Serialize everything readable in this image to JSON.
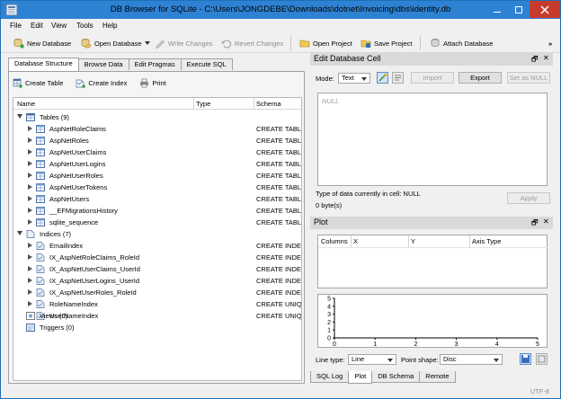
{
  "window": {
    "title": "DB Browser for SQLite - C:\\Users\\JONGDEBE\\Downloads\\dotnet\\Invoicing\\dbs\\identity.db"
  },
  "menu": [
    "File",
    "Edit",
    "View",
    "Tools",
    "Help"
  ],
  "toolbar": {
    "new_database": "New Database",
    "open_database": "Open Database",
    "write_changes": "Write Changes",
    "revert_changes": "Revert Changes",
    "open_project": "Open Project",
    "save_project": "Save Project",
    "attach_database": "Attach Database",
    "overflow": "»"
  },
  "left_tabs": [
    "Database Structure",
    "Browse Data",
    "Edit Pragmas",
    "Execute SQL"
  ],
  "structure_toolbar": {
    "create_table": "Create Table",
    "create_index": "Create Index",
    "print": "Print"
  },
  "tree_columns": {
    "name": "Name",
    "type": "Type",
    "schema": "Schema"
  },
  "tree": {
    "tables_label": "Tables (9)",
    "tables": [
      {
        "name": "AspNetRoleClaims",
        "schema": "CREATE TABLE"
      },
      {
        "name": "AspNetRoles",
        "schema": "CREATE TABLE"
      },
      {
        "name": "AspNetUserClaims",
        "schema": "CREATE TABLE"
      },
      {
        "name": "AspNetUserLogins",
        "schema": "CREATE TABLE"
      },
      {
        "name": "AspNetUserRoles",
        "schema": "CREATE TABLE"
      },
      {
        "name": "AspNetUserTokens",
        "schema": "CREATE TABLE"
      },
      {
        "name": "AspNetUsers",
        "schema": "CREATE TABLE"
      },
      {
        "name": "__EFMigrationsHistory",
        "schema": "CREATE TABLE"
      },
      {
        "name": "sqlite_sequence",
        "schema": "CREATE TABLE"
      }
    ],
    "indices_label": "Indices (7)",
    "indices": [
      {
        "name": "EmailIndex",
        "schema": "CREATE INDEX"
      },
      {
        "name": "IX_AspNetRoleClaims_RoleId",
        "schema": "CREATE INDEX"
      },
      {
        "name": "IX_AspNetUserClaims_UserId",
        "schema": "CREATE INDEX"
      },
      {
        "name": "IX_AspNetUserLogins_UserId",
        "schema": "CREATE INDEX"
      },
      {
        "name": "IX_AspNetUserRoles_RoleId",
        "schema": "CREATE INDEX"
      },
      {
        "name": "RoleNameIndex",
        "schema": "CREATE UNIQUE"
      },
      {
        "name": "UserNameIndex",
        "schema": "CREATE UNIQUE"
      }
    ],
    "views_label": "Views (0)",
    "triggers_label": "Triggers (0)"
  },
  "edit_cell": {
    "title": "Edit Database Cell",
    "mode_label": "Mode:",
    "mode_value": "Text",
    "import": "Import",
    "export": "Export",
    "set_null": "Set as NULL",
    "placeholder": "NULL",
    "type_info": "Type of data currently in cell: NULL",
    "size_info": "0 byte(s)",
    "apply": "Apply"
  },
  "plot": {
    "title": "Plot",
    "columns": [
      "Columns",
      "X",
      "Y",
      "Axis Type"
    ],
    "y_ticks": [
      "5",
      "4",
      "3",
      "2",
      "1",
      "0"
    ],
    "x_ticks": [
      "0",
      "1",
      "2",
      "3",
      "4",
      "5"
    ],
    "line_type_label": "Line type:",
    "line_type_value": "Line",
    "point_shape_label": "Point shape:",
    "point_shape_value": "Disc"
  },
  "dock_controls": {
    "float": "🗗",
    "close": "✕"
  },
  "bottom_tabs": [
    "SQL Log",
    "Plot",
    "DB Schema",
    "Remote"
  ],
  "status": {
    "encoding": "UTF-8"
  },
  "colors": {
    "titlebar": "#2e82d3",
    "close": "#c73b2f",
    "dock_header": "#d9d9d9"
  }
}
